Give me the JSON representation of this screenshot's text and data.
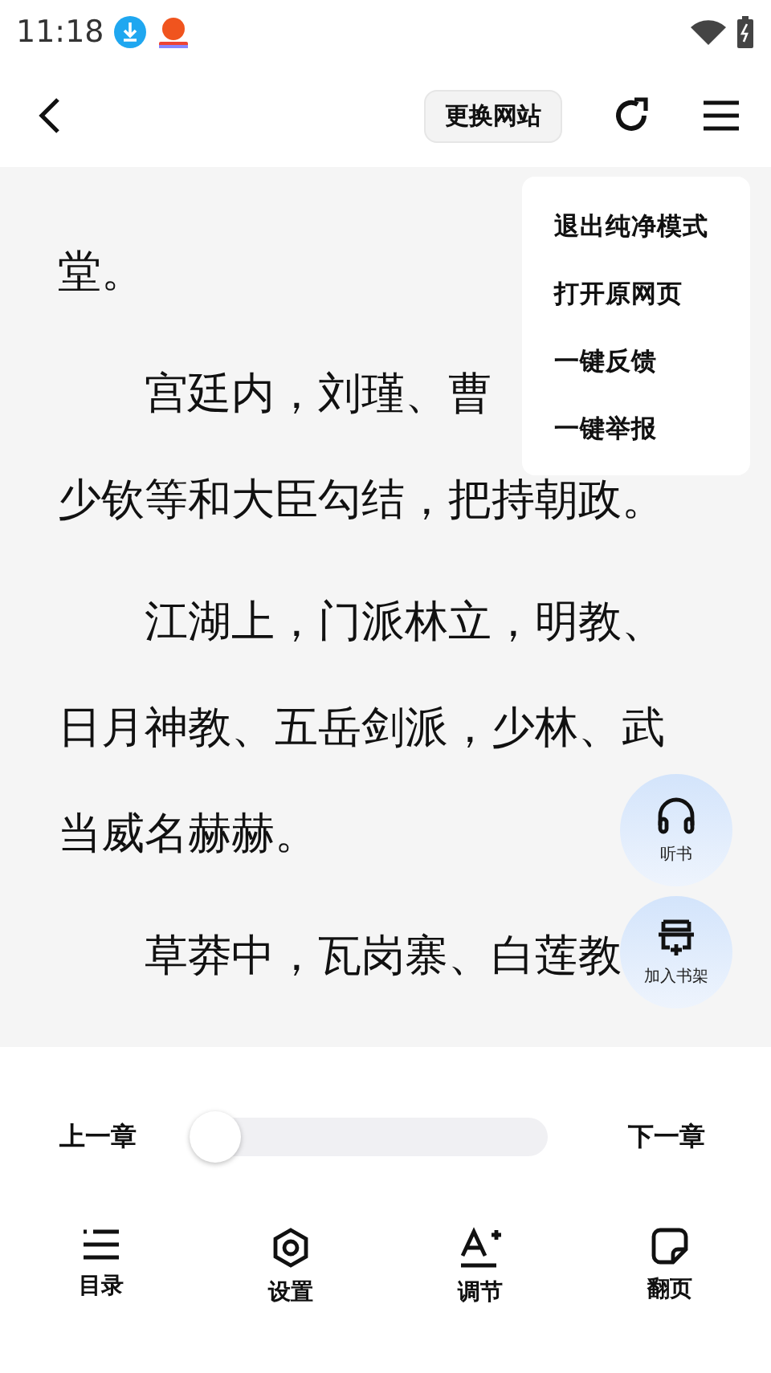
{
  "status_bar": {
    "time": "11:18"
  },
  "header": {
    "switch_site": "更换网站"
  },
  "paragraphs": [
    {
      "indent": false,
      "lines": [
        "堂。"
      ]
    },
    {
      "indent": true,
      "lines": [
        "宫廷内，刘瑾、曹",
        "少钦等和大臣勾结，把持朝政。"
      ]
    },
    {
      "indent": true,
      "lines": [
        "江湖上，门派林立，明教、",
        "日月神教、五岳剑派，少林、武",
        "当威名赫赫。"
      ]
    },
    {
      "indent": true,
      "lines": [
        "草莽中，瓦岗寨、白莲教"
      ]
    }
  ],
  "menu": [
    "退出纯净模式",
    "打开原网页",
    "一键反馈",
    "一键举报"
  ],
  "floating_buttons": [
    {
      "kind": "listen",
      "label": "听书"
    },
    {
      "kind": "shelf",
      "label": "加入书架"
    }
  ],
  "chapter": {
    "previous": "上一章",
    "next": "下一章",
    "level": 0
  },
  "nav": [
    {
      "kind": "contents",
      "label": "目录"
    },
    {
      "kind": "settings",
      "label": "设置"
    },
    {
      "kind": "font",
      "label": "调节"
    },
    {
      "kind": "page",
      "label": "翻页"
    }
  ]
}
